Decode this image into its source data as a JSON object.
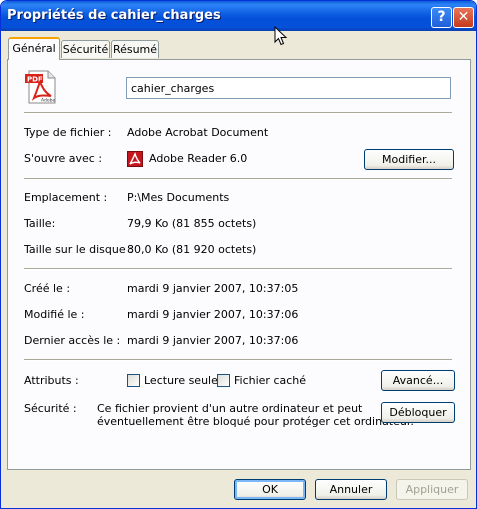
{
  "window": {
    "title": "Propriétés de cahier_charges",
    "help_label": "?",
    "close_label": "✕"
  },
  "tabs": [
    {
      "label": "Général",
      "active": true
    },
    {
      "label": "Sécurité",
      "active": false
    },
    {
      "label": "Résumé",
      "active": false
    }
  ],
  "file": {
    "icon": "pdf-file-icon",
    "name": "cahier_charges"
  },
  "general": {
    "type_label": "Type de fichier :",
    "type_value": "Adobe Acrobat Document",
    "opens_label": "S'ouvre avec :",
    "opens_value": "Adobe Reader 6.0",
    "opens_icon": "adobe-reader-icon",
    "modify_button": "Modifier...",
    "location_label": "Emplacement :",
    "location_value": "P:\\Mes Documents",
    "size_label": "Taille:",
    "size_value": "79,9 Ko (81 855 octets)",
    "disk_size_label": "Taille sur le disque :",
    "disk_size_value": "80,0 Ko (81 920 octets)",
    "created_label": "Créé le :",
    "created_value": "mardi 9 janvier 2007, 10:37:05",
    "modified_label": "Modifié le :",
    "modified_value": "mardi 9 janvier 2007, 10:37:06",
    "accessed_label": "Dernier accès le :",
    "accessed_value": "mardi 9 janvier 2007, 10:37:06",
    "attributes_label": "Attributs :",
    "readonly_label": "Lecture seule",
    "readonly_checked": false,
    "hidden_label": "Fichier caché",
    "hidden_checked": false,
    "advanced_button": "Avancé...",
    "security_label": "Sécurité :",
    "security_text_line1": "Ce fichier provient d'un autre ordinateur et peut",
    "security_text_line2": "éventuellement être bloqué pour protéger cet ordinateur.",
    "unblock_button": "Débloquer"
  },
  "footer": {
    "ok": "OK",
    "cancel": "Annuler",
    "apply": "Appliquer"
  },
  "colors": {
    "titlebar": "#0054e3",
    "window_bg": "#ece9d8",
    "panel_bg": "#fcfcfe",
    "active_tab_accent": "#f7a300"
  }
}
